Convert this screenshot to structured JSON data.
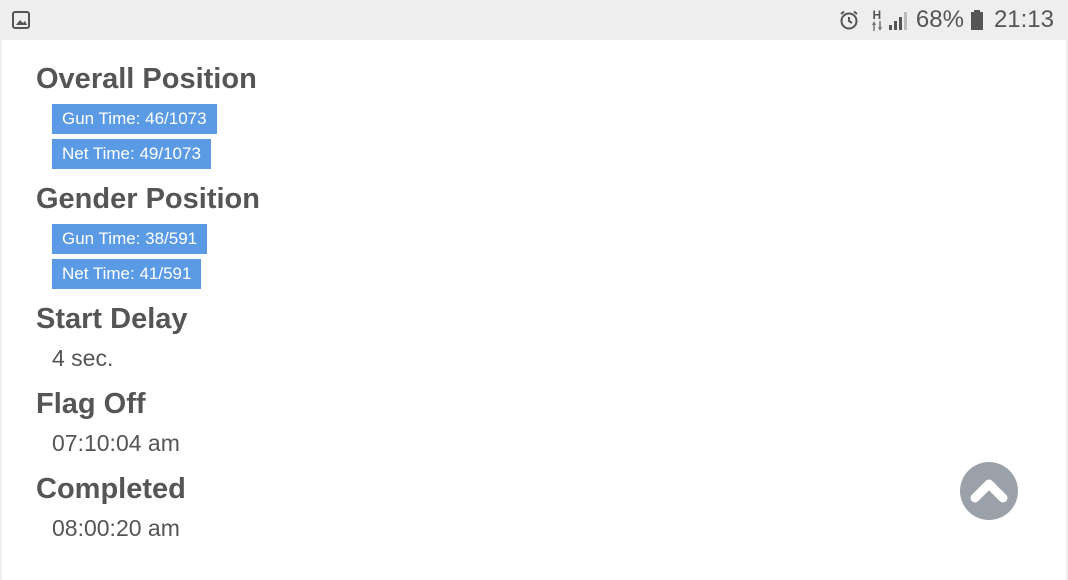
{
  "status_bar": {
    "left_icon": "image-icon",
    "icons": [
      "alarm-icon",
      "hplus-data-icon",
      "signal-icon",
      "battery-icon"
    ],
    "network_label": "H",
    "battery_percent": "68%",
    "time": "21:13"
  },
  "overall_position": {
    "title": "Overall Position",
    "gun_time": "Gun Time: 46/1073",
    "net_time": "Net Time: 49/1073"
  },
  "gender_position": {
    "title": "Gender Position",
    "gun_time": "Gun Time: 38/591",
    "net_time": "Net Time: 41/591"
  },
  "start_delay": {
    "title": "Start Delay",
    "value": "4 sec."
  },
  "flag_off": {
    "title": "Flag Off",
    "value": "07:10:04 am"
  },
  "completed": {
    "title": "Completed",
    "value": "08:00:20 am"
  },
  "scroll_top_button": {
    "icon": "chevron-up-icon"
  },
  "colors": {
    "badge": "#5b9be6",
    "text": "#555555",
    "scroll_button": "#9aa1a8",
    "status_bar": "#eeeeee"
  }
}
